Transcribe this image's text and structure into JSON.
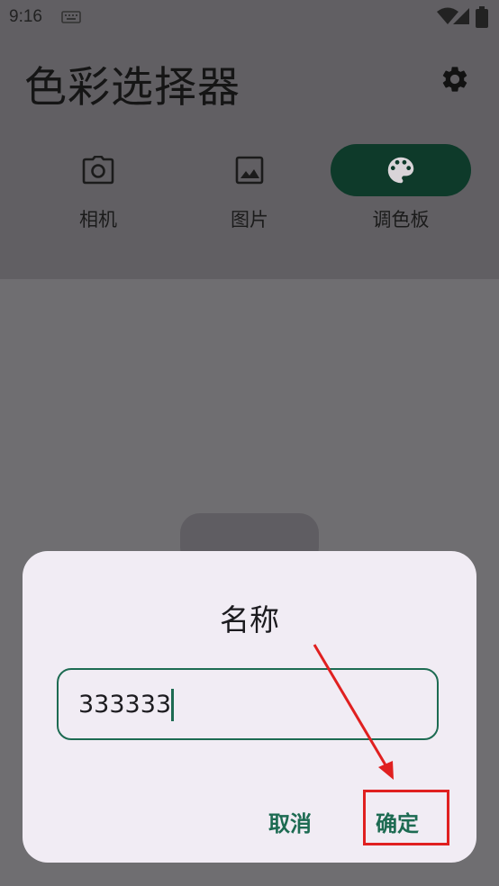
{
  "status_bar": {
    "time": "9:16"
  },
  "header": {
    "title": "色彩选择器",
    "settings_icon": "gear-icon"
  },
  "nav": {
    "items": [
      {
        "label": "相机",
        "icon": "camera-icon",
        "active": false
      },
      {
        "label": "图片",
        "icon": "image-icon",
        "active": false
      },
      {
        "label": "调色板",
        "icon": "palette-icon",
        "active": true
      }
    ]
  },
  "dialog": {
    "title": "名称",
    "input_value": "333333",
    "cancel_label": "取消",
    "confirm_label": "确定"
  },
  "colors": {
    "accent": "#1d6b52",
    "active_pill": "#0e3a2a",
    "annotation": "#e02020",
    "dialog_bg": "#f1ecf4"
  }
}
